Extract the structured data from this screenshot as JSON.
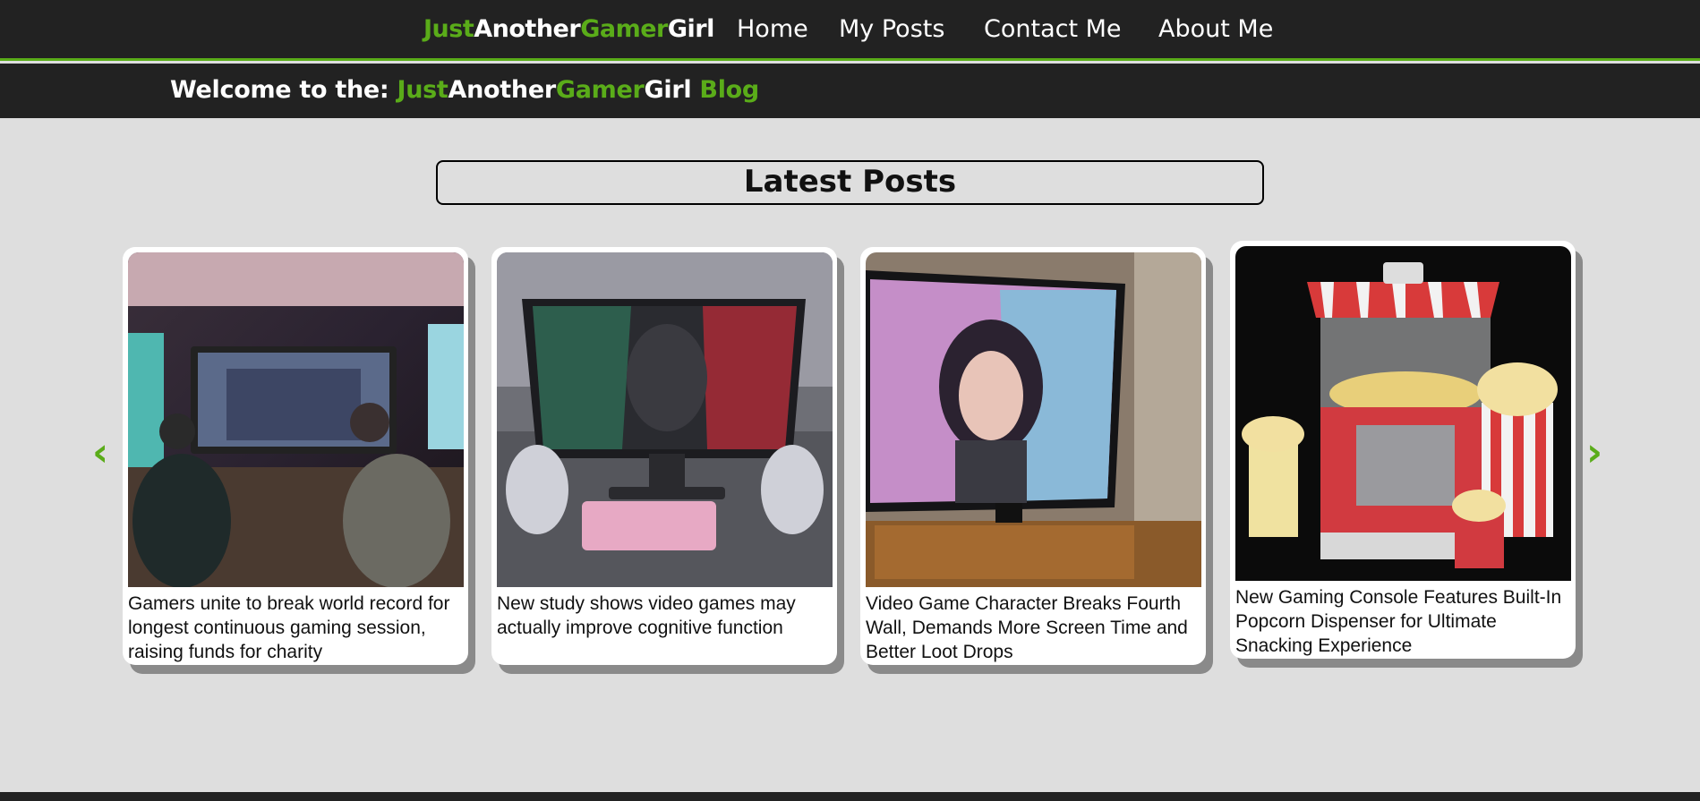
{
  "nav": {
    "brand": [
      "Just",
      "Another",
      "Gamer",
      "Girl"
    ],
    "links": [
      "Home",
      "My Posts",
      "Contact Me",
      "About Me"
    ]
  },
  "welcome": {
    "prefix": "Welcome to the: ",
    "brand": [
      "Just",
      "Another",
      "Gamer",
      "Girl"
    ],
    "suffix": " Blog"
  },
  "section_title": "Latest Posts",
  "carousel": {
    "prev": "‹",
    "next": "›",
    "posts": [
      {
        "title": "Gamers unite to break world record for longest continuous gaming session, raising funds for charity",
        "image": "gamers-room-image"
      },
      {
        "title": "New study shows video games may actually improve cognitive function",
        "image": "gaming-monitor-image"
      },
      {
        "title": "Video Game Character Breaks Fourth Wall, Demands More Screen Time and Better Loot Drops",
        "image": "tv-character-image"
      },
      {
        "title": "New Gaming Console Features Built-In Popcorn Dispenser for Ultimate Snacking Experience",
        "image": "popcorn-machine-image"
      }
    ]
  },
  "colors": {
    "accent": "#5aac19",
    "nav_bg": "#222222",
    "page_bg": "#dedede"
  }
}
